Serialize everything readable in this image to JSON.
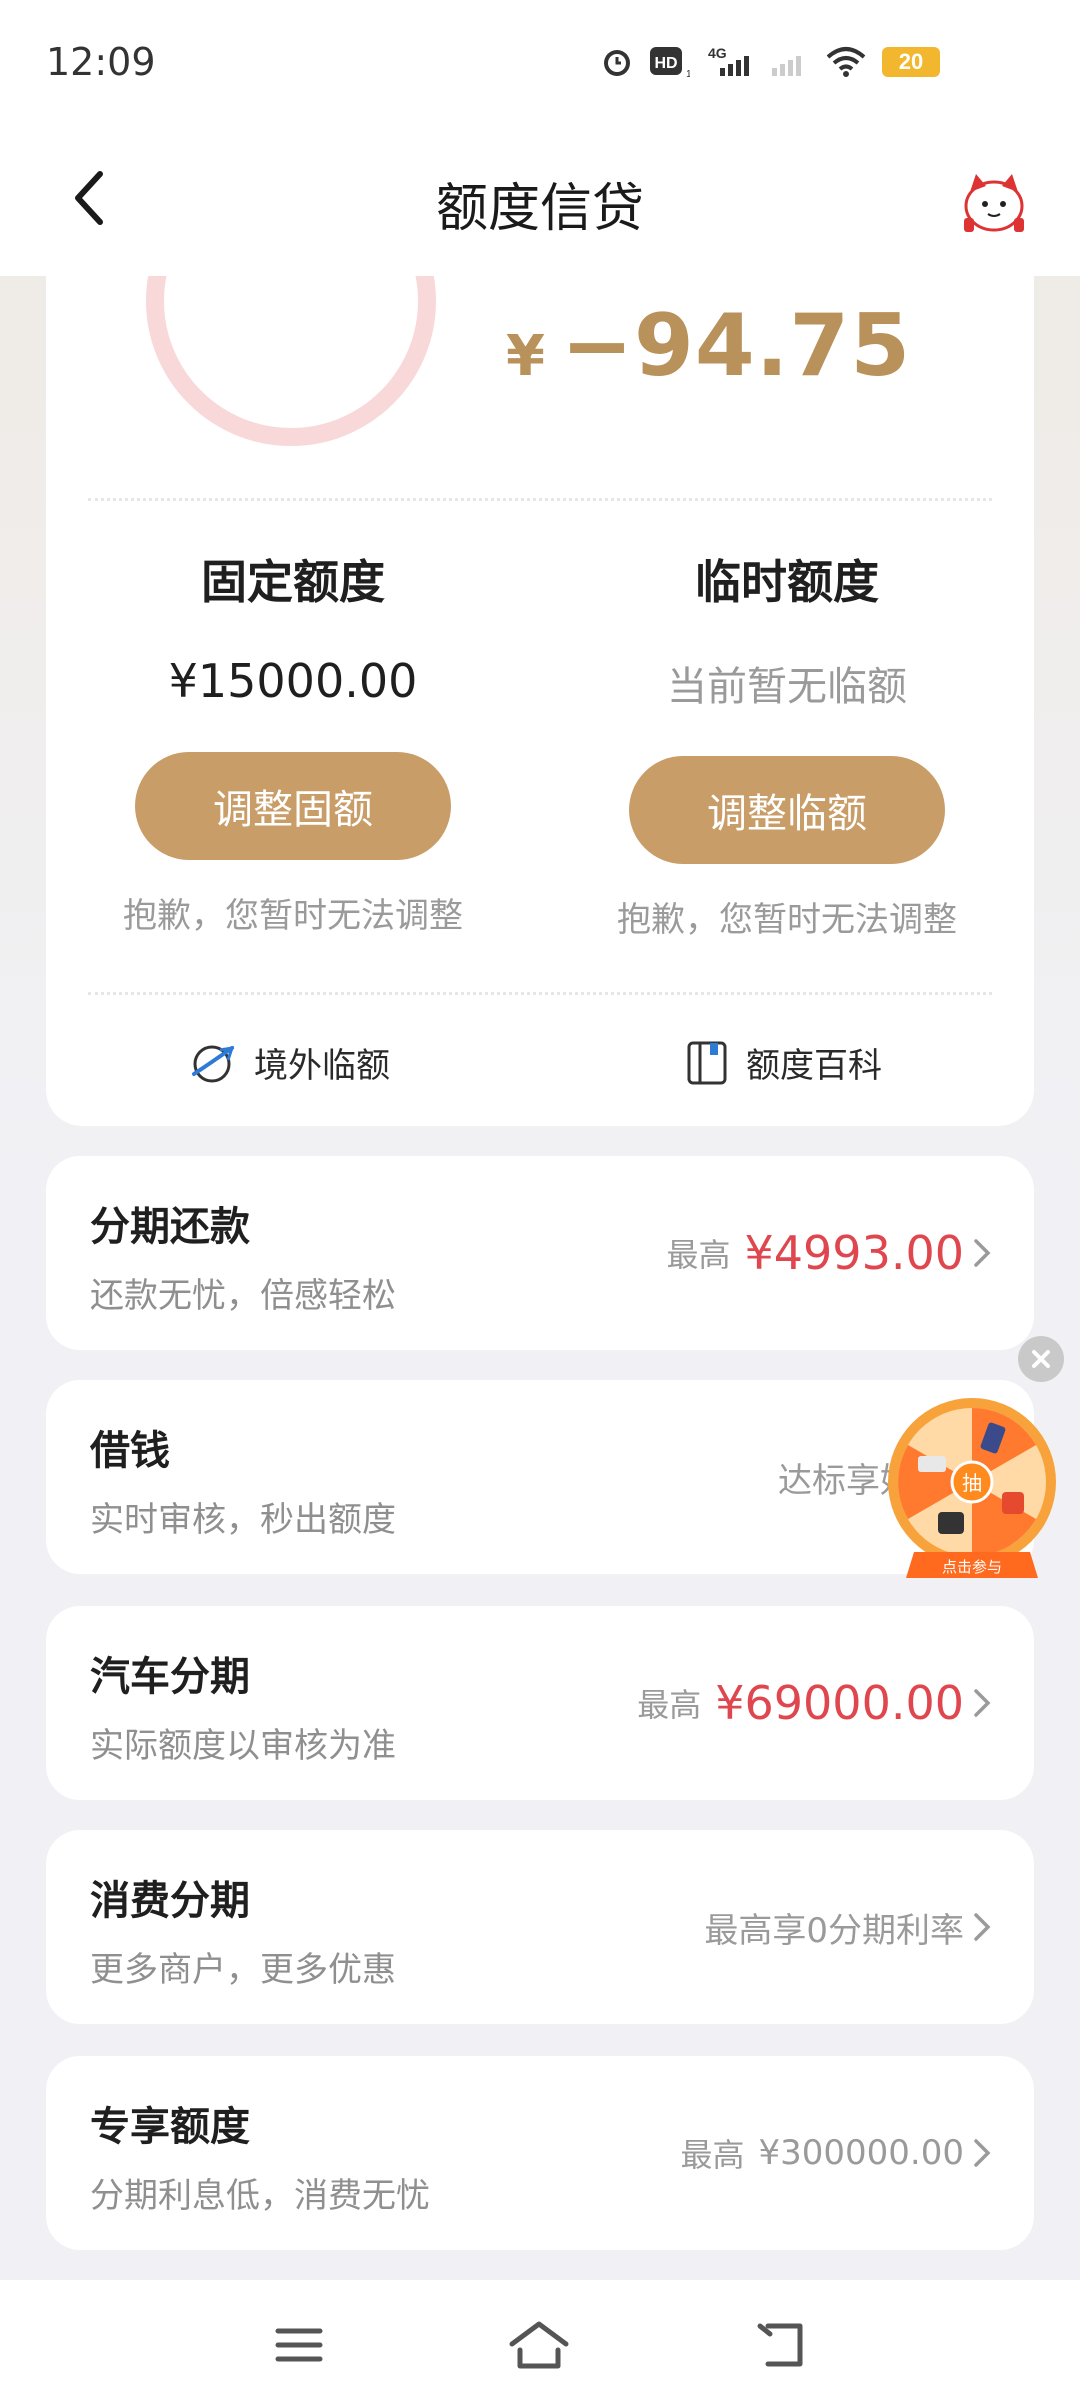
{
  "status_bar": {
    "time": "12:09",
    "battery_level": "20",
    "icons": [
      "alarm-icon",
      "hd-icon",
      "signal-4g-icon",
      "signal-icon",
      "wifi-icon",
      "battery-icon"
    ],
    "hd_label": "HD",
    "net_label": "4G"
  },
  "header": {
    "title": "额度信贷",
    "back_icon": "back-chevron-icon",
    "mascot_icon": "mascot-icon"
  },
  "credit": {
    "currency_symbol": "¥",
    "balance": "−94.75",
    "fixed": {
      "title": "固定额度",
      "amount": "¥15000.00",
      "button": "调整固额",
      "note": "抱歉，您暂时无法调整"
    },
    "temp": {
      "title": "临时额度",
      "amount": "当前暂无临额",
      "button": "调整临额",
      "note": "抱歉，您暂时无法调整"
    },
    "links": [
      {
        "label": "境外临额",
        "icon": "overseas-icon"
      },
      {
        "label": "额度百科",
        "icon": "book-icon"
      }
    ]
  },
  "products": [
    {
      "title": "分期还款",
      "subtitle": "还款无忧，倍感轻松",
      "prefix": "最高",
      "amount": "¥4993.00"
    },
    {
      "title": "借钱",
      "subtitle": "实时审核，秒出额度",
      "text": "达标享好利"
    },
    {
      "title": "汽车分期",
      "subtitle": "实际额度以审核为准",
      "prefix": "最高",
      "amount": "¥69000.00"
    },
    {
      "title": "消费分期",
      "subtitle": "更多商户，更多优惠",
      "text": "最高享0分期利率"
    },
    {
      "title": "专享额度",
      "subtitle": "分期利息低，消费无忧",
      "prefix": "最高",
      "amount": "¥300000.00"
    }
  ],
  "floating": {
    "center_label": "抽",
    "caption": "点击参与",
    "close_icon": "close-icon"
  },
  "colors": {
    "accent_gold": "#c99d67",
    "balance_gold": "#b9915a",
    "amount_red": "#e0464e",
    "ring_pink": "#f8d8d9"
  },
  "nav_bar": {
    "icons": [
      "menu-icon",
      "home-icon",
      "back-icon"
    ]
  }
}
